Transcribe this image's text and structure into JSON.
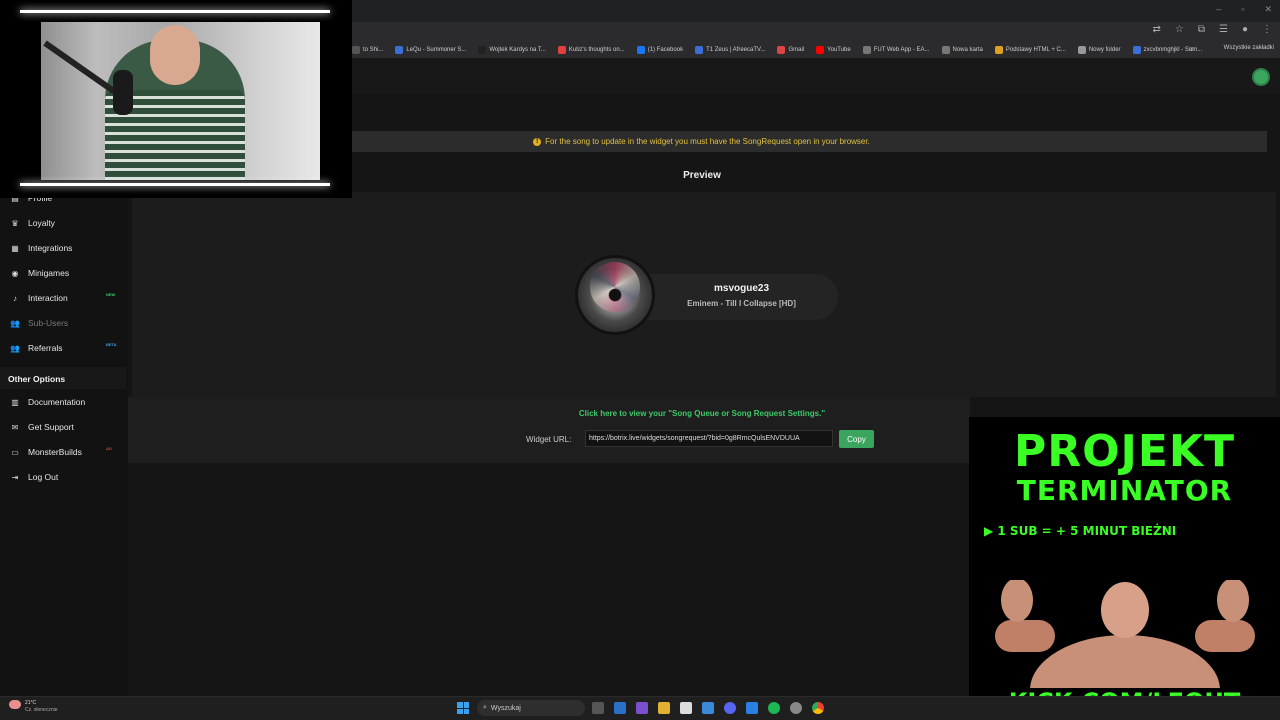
{
  "bookmarks": [
    {
      "label": "to Shi...",
      "color": "#555"
    },
    {
      "label": "LeQu - Summoner S...",
      "color": "#3a6fd8"
    },
    {
      "label": "Wojtek Kardys na T...",
      "color": "#222"
    },
    {
      "label": "Kubz's thoughts on...",
      "color": "#e04040"
    },
    {
      "label": "(1) Facebook",
      "color": "#1877f2"
    },
    {
      "label": "T1 Zeus | AfreecaTV...",
      "color": "#3a6fd8"
    },
    {
      "label": "Gmail",
      "color": "#d44"
    },
    {
      "label": "YouTube",
      "color": "#f00"
    },
    {
      "label": "FUT Web App - EA...",
      "color": "#777"
    },
    {
      "label": "Nowa karta",
      "color": "#777"
    },
    {
      "label": "Podstawy HTML + C...",
      "color": "#e0a020"
    },
    {
      "label": "Nowy folder",
      "color": "#999"
    },
    {
      "label": "zxcvbnmghjkl - Sum...",
      "color": "#3a6fd8"
    }
  ],
  "bookmarks_all": "Wszystkie zakładki",
  "alert_text": "For the song to update in the widget you must have the SongRequest open in your browser.",
  "preview_title": "Preview",
  "song": {
    "user": "msvogue23",
    "title": "Eminem - Till I Collapse [HD]"
  },
  "queue_link": "Click here to view your \"Song Queue or Song Request Settings.\"",
  "widget_url_label": "Widget URL:",
  "widget_url": "https://botrix.live/widgets/songrequest/?bid=0g8RmcQulsENVDUUA",
  "copy_label": "Copy",
  "sidebar": {
    "items": [
      {
        "label": "Profile",
        "icon": "id-card-icon"
      },
      {
        "label": "Loyalty",
        "icon": "trophy-icon"
      },
      {
        "label": "Integrations",
        "icon": "list-icon"
      },
      {
        "label": "Minigames",
        "icon": "gamepad-icon"
      },
      {
        "label": "Interaction",
        "icon": "music-icon",
        "tag": "NEW"
      },
      {
        "label": "Sub-Users",
        "icon": "users-icon"
      },
      {
        "label": "Referrals",
        "icon": "users-icon",
        "tag": "BETA"
      }
    ],
    "other_title": "Other Options",
    "other_items": [
      {
        "label": "Documentation",
        "icon": "doc-icon"
      },
      {
        "label": "Get Support",
        "icon": "mail-icon"
      },
      {
        "label": "MonsterBuilds",
        "icon": "laptop-icon",
        "tag": "AD"
      },
      {
        "label": "Log Out",
        "icon": "logout-icon"
      }
    ]
  },
  "promo": {
    "line1": "PROJEKT",
    "line2": "TERMINATOR",
    "line3": "1 SUB = + 5 MINUT BIEŻNI",
    "url": "KICK.COM/LEQUT"
  },
  "taskbar": {
    "weather_temp": "21°C",
    "weather_desc": "Cz. słonecznie",
    "search": "Wyszukaj"
  },
  "colors": {
    "accent_green": "#3ba55d",
    "alert_yellow": "#e0c040",
    "promo_green": "#39ff24"
  }
}
